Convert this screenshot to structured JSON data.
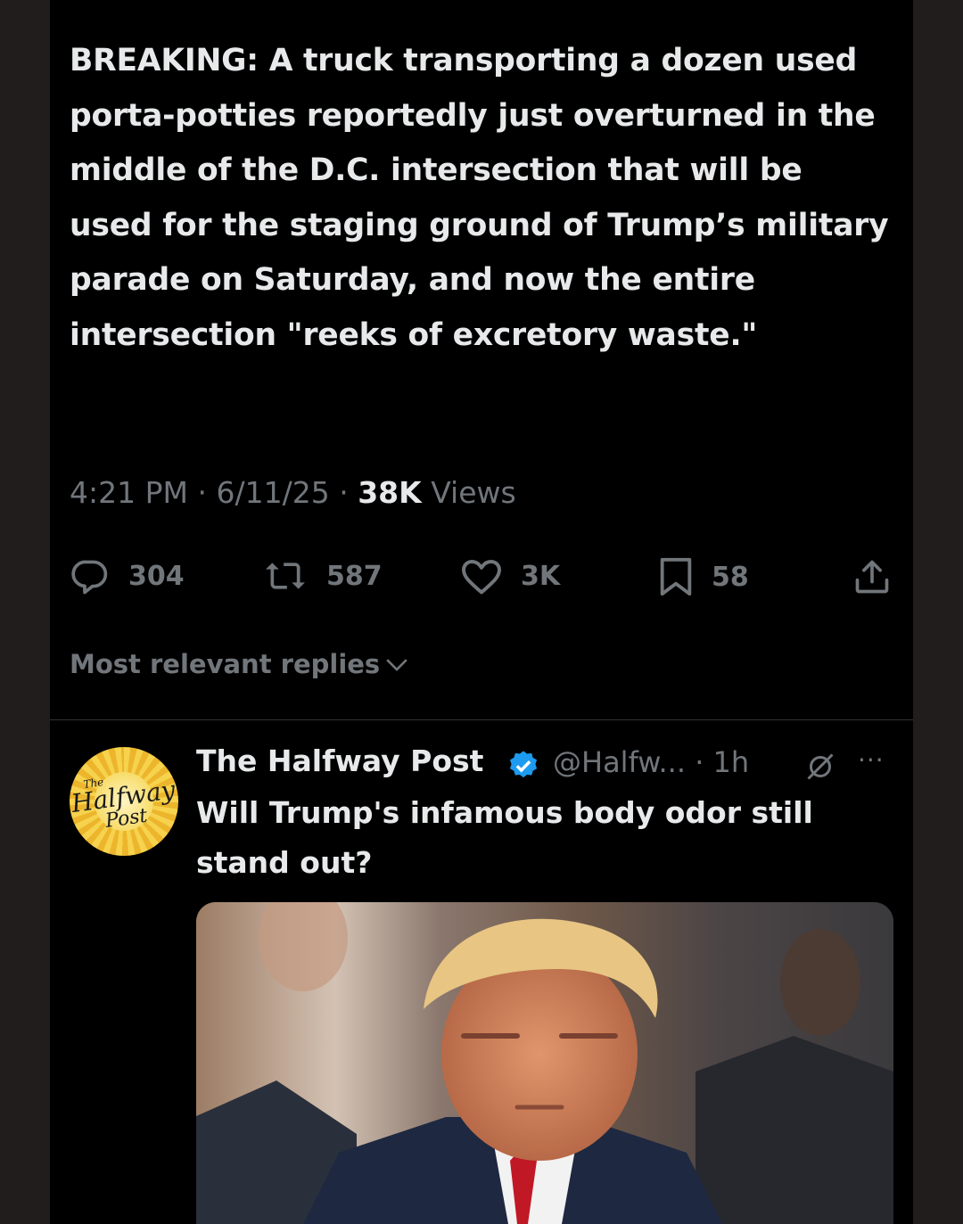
{
  "tweet": {
    "text": "BREAKING: A truck transporting a dozen used porta-potties reportedly just overturned in the middle of the D.C. intersection that will be used for the staging ground of Trump’s military parade on Saturday, and now the entire intersection \"reeks of excretory waste.\"",
    "time": "4:21 PM",
    "date": "6/11/25",
    "views_count": "38K",
    "views_label": "Views",
    "separator": "·"
  },
  "actions": {
    "replies": "304",
    "reposts": "587",
    "likes": "3K",
    "bookmarks": "58"
  },
  "replies_sort": {
    "label": "Most relevant replies"
  },
  "reply": {
    "avatar_text_1": "The",
    "avatar_text_2": "Halfway",
    "avatar_text_3": "Post",
    "author": "The Halfway Post",
    "handle": "@Halfw...",
    "age": "1h",
    "more": "···",
    "text": "Will Trump's infamous body odor still stand out?"
  },
  "colors": {
    "background": "#000000",
    "outer": "#221d1d",
    "text_primary": "#e7e9ea",
    "text_secondary": "#71767b",
    "verified": "#1d9bf0"
  },
  "icons": [
    "reply-icon",
    "repost-icon",
    "like-icon",
    "bookmark-icon",
    "share-icon",
    "chevron-down-icon",
    "verified-icon",
    "grok-icon",
    "more-icon"
  ]
}
